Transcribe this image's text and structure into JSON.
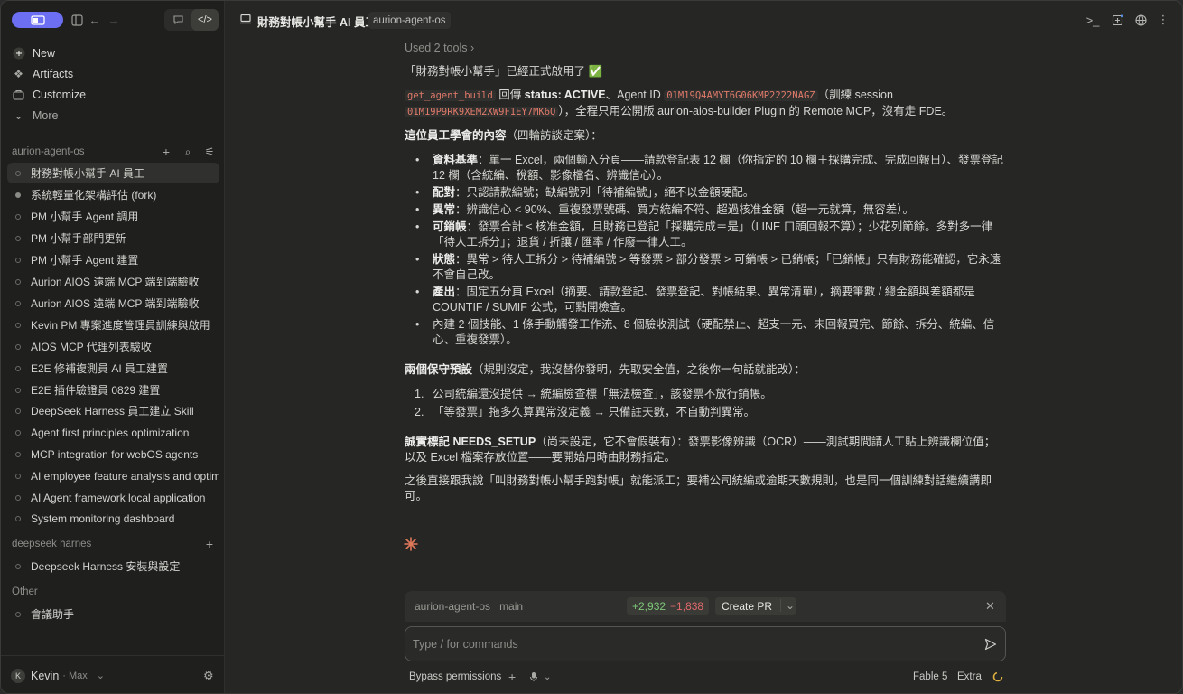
{
  "sidebar": {
    "nav": [
      {
        "label": "New",
        "icon": "plus-icon"
      },
      {
        "label": "Artifacts",
        "icon": "artifacts-icon"
      },
      {
        "label": "Customize",
        "icon": "customize-icon"
      },
      {
        "label": "More",
        "icon": "chevron-down-icon"
      }
    ],
    "sections": [
      {
        "title": "aurion-agent-os",
        "items": [
          "財務對帳小幫手 AI 員工",
          "系統輕量化架構評估 (fork)",
          "PM 小幫手 Agent 調用",
          "PM 小幫手部門更新",
          "PM 小幫手 Agent 建置",
          "Aurion AIOS 遠端 MCP 端到端驗收",
          "Aurion AIOS 遠端 MCP 端到端驗收",
          "Kevin PM 專案進度管理員訓練與啟用",
          "AIOS MCP 代理列表驗收",
          "E2E 修補複測員 AI 員工建置",
          "E2E 插件驗證員 0829 建置",
          "DeepSeek Harness 員工建立 Skill",
          "Agent first principles optimization",
          "MCP integration for webOS agents",
          "AI employee feature analysis and optim",
          "AI Agent framework local application",
          "System monitoring dashboard"
        ]
      },
      {
        "title": "deepseek harnes",
        "items": [
          "Deepseek Harness 安裝與設定"
        ]
      },
      {
        "title": "Other",
        "items": [
          "會議助手"
        ]
      }
    ],
    "user": {
      "initial": "K",
      "name": "Kevin",
      "plan": "· Max"
    }
  },
  "header": {
    "title": "財務對帳小幫手 AI 員工",
    "badge": "aurion-agent-os"
  },
  "message": {
    "used_tools": "Used 2 tools",
    "p1": "「財務對帳小幫手」已經正式啟用了 ✅",
    "p2_code1": "get_agent_build",
    "p2_a": " 回傳 ",
    "p2_status": "status: ACTIVE",
    "p2_b": "、Agent ID ",
    "p2_code2": "01M19Q4AMYT6G06KMP2222NAGZ",
    "p2_c": "（訓練 session ",
    "p2_code3": "01M19P9RK9XEM2XW9F1EY7MK6Q",
    "p2_d": "），全程只用公開版 aurion-aios-builder Plugin 的 Remote MCP，沒有走 FDE。",
    "h1_bold": "這位員工學會的內容",
    "h1_rest": "（四輪訪談定案）：",
    "bullets": [
      {
        "k": "資料基準",
        "v": "：單一 Excel，兩個輸入分頁——請款登記表 12 欄（你指定的 10 欄＋採購完成、完成回報日）、發票登記 12 欄（含統編、稅額、影像檔名、辨識信心）。"
      },
      {
        "k": "配對",
        "v": "：只認請款編號；缺編號列「待補編號」，絕不以金額硬配。"
      },
      {
        "k": "異常",
        "v": "：辨識信心 < 90%、重複發票號碼、買方統編不符、超過核准金額（超一元就算，無容差）。"
      },
      {
        "k": "可銷帳",
        "v": "：發票合計 ≤ 核准金額，且財務已登記「採購完成＝是」（LINE 口頭回報不算）；少花列節餘。多對多一律「待人工拆分」；退貨 / 折讓 / 匯率 / 作廢一律人工。"
      },
      {
        "k": "狀態",
        "v": "：異常 > 待人工拆分 > 待補編號 > 等發票 > 部分發票 > 可銷帳 > 已銷帳；「已銷帳」只有財務能確認，它永遠不會自己改。"
      },
      {
        "k": "產出",
        "v": "：固定五分頁 Excel（摘要、請款登記、發票登記、對帳結果、異常清單），摘要筆數 / 總金額與差額都是 COUNTIF / SUMIF 公式，可點開檢查。"
      },
      {
        "k": "",
        "v": "內建 2 個技能、1 條手動觸發工作流、8 個驗收測試（硬配禁止、超支一元、未回報買完、節餘、拆分、統編、信心、重複發票）。"
      }
    ],
    "h2_bold": "兩個保守預設",
    "h2_rest": "（規則沒定，我沒替你發明，先取安全值，之後你一句話就能改）：",
    "numbered": [
      {
        "n": "1.",
        "t": "公司統編還沒提供 → 統編檢查標「無法檢查」，該發票不放行銷帳。"
      },
      {
        "n": "2.",
        "t": "「等發票」拖多久算異常沒定義 → 只備註天數，不自動判異常。"
      }
    ],
    "p3_bold": "誠實標記 NEEDS_SETUP",
    "p3_rest": "（尚未設定，它不會假裝有）：發票影像辨識（OCR）——測試期間請人工貼上辨識欄位值；以及 Excel 檔案存放位置——要開始用時由財務指定。",
    "p4": "之後直接跟我說「叫財務對帳小幫手跑對帳」就能派工；要補公司統編或逾期天數規則，也是同一個訓練對話繼續講即可。"
  },
  "composer": {
    "repo": "aurion-agent-os",
    "branch": "main",
    "additions": "+2,932",
    "deletions": "−1,838",
    "create_pr": "Create PR",
    "placeholder": "Type / for commands",
    "bypass": "Bypass permissions",
    "model": "Fable 5",
    "effort": "Extra"
  },
  "colors": {
    "accent": "#6d6ff2",
    "add": "#7fc97a",
    "del": "#e06a6a",
    "spark": "#e0795a"
  }
}
